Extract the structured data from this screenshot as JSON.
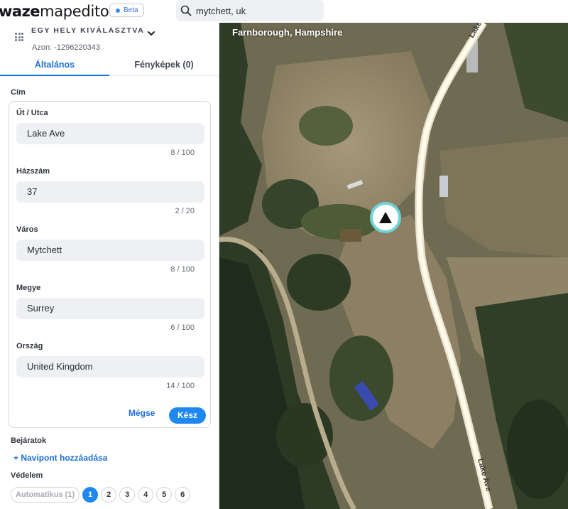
{
  "app": {
    "logo_bold": "waze",
    "logo_regular": "mapeditor",
    "beta_label": "Beta",
    "search_value": "mytchett, uk"
  },
  "place": {
    "title": "EGY HELY KIVÁLASZTVA",
    "id_text": "Azon: -1296220343"
  },
  "tabs": [
    {
      "label": "Általános",
      "active": true
    },
    {
      "label": "Fényképek (0)",
      "active": false
    }
  ],
  "address": {
    "section_label": "Cím",
    "fields": [
      {
        "label": "Út / Utca",
        "value": "Lake Ave",
        "counter": "8 / 100"
      },
      {
        "label": "Házszám",
        "value": "37",
        "counter": "2 / 20"
      },
      {
        "label": "Város",
        "value": "Mytchett",
        "counter": "8 / 100"
      },
      {
        "label": "Megye",
        "value": "Surrey",
        "counter": "6 / 100"
      },
      {
        "label": "Ország",
        "value": "United Kingdom",
        "counter": "14 / 100"
      }
    ],
    "cancel_label": "Mégse",
    "done_label": "Kész"
  },
  "entrances": {
    "label": "Bejáratok",
    "add_link": "+ Navipont hozzáadása"
  },
  "lock": {
    "label": "Védelem",
    "auto_label": "Automatikus (1)",
    "levels": [
      "1",
      "2",
      "3",
      "4",
      "5",
      "6"
    ],
    "selected": "1"
  },
  "map": {
    "area_label": "Farnborough, Hampshire",
    "road_name": "Lake Ave"
  },
  "colors": {
    "accent": "#1e88f0",
    "link": "#1e6fd9"
  }
}
